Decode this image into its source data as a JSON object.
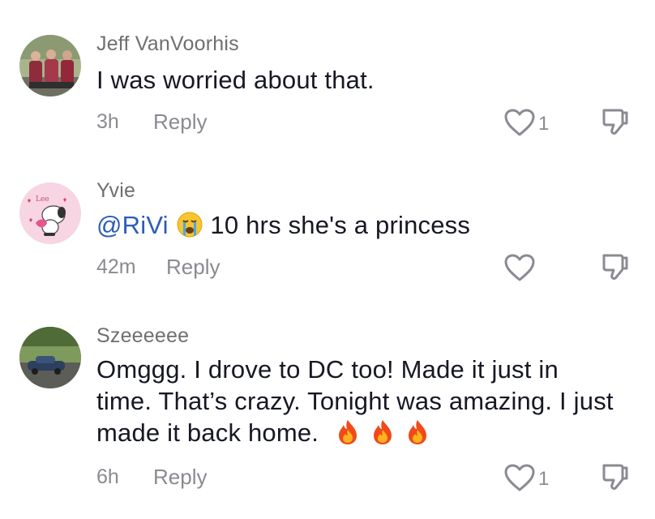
{
  "comments": [
    {
      "username": "Jeff VanVoorhis",
      "text": "I was worried about that.",
      "time": "3h",
      "reply_label": "Reply",
      "like_count": "1"
    },
    {
      "username": "Yvie",
      "mention": "@RiVi",
      "text": "10 hrs she's a princess",
      "emoji": "loudly-crying-face",
      "time": "42m",
      "reply_label": "Reply",
      "like_count": "",
      "avatar_text": "Lee"
    },
    {
      "username": "Szeeeeee",
      "text_line1": "Omggg. I drove to DC too! Made it just in",
      "text_line2": "time. That’s crazy. Tonight was amazing. I just",
      "text_line3": "made it back home.",
      "emoji": "fire",
      "time": "6h",
      "reply_label": "Reply",
      "like_count": "1"
    }
  ],
  "colors": {
    "text": "#161823",
    "secondary": "#8a8b91",
    "mention": "#2b5db9"
  }
}
